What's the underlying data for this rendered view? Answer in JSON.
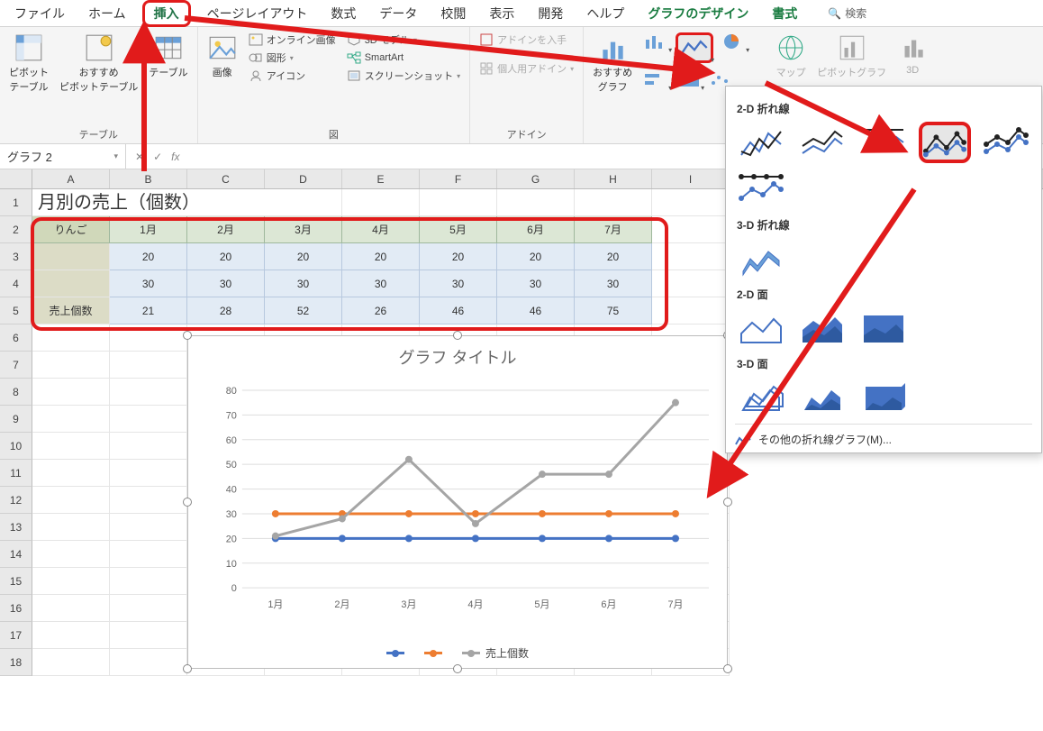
{
  "tabs": {
    "file": "ファイル",
    "home": "ホーム",
    "insert": "挿入",
    "layout": "ページレイアウト",
    "formula": "数式",
    "data": "データ",
    "review": "校閲",
    "view": "表示",
    "dev": "開発",
    "help": "ヘルプ",
    "chartdesign": "グラフのデザイン",
    "format": "書式",
    "search": "検索"
  },
  "ribbon": {
    "group_table": "テーブル",
    "pivot": "ピボット\nテーブル",
    "recpivot": "おすすめ\nピボットテーブル",
    "table": "テーブル",
    "group_illust": "図",
    "picture": "画像",
    "online_image": "オンライン画像",
    "shapes": "図形",
    "icons": "アイコン",
    "model3d": "3D モデル",
    "smartart": "SmartArt",
    "screenshot": "スクリーンショット",
    "group_addin": "アドイン",
    "get_addin": "アドインを入手",
    "my_addin": "個人用アドイン",
    "rec_chart": "おすすめ\nグラフ",
    "map": "マップ",
    "pivotchart": "ピボットグラフ",
    "threeD": "3D"
  },
  "namebox": "グラフ 2",
  "sheet": {
    "cols": [
      "A",
      "B",
      "C",
      "D",
      "E",
      "F",
      "G",
      "H",
      "I"
    ],
    "title": "月別の売上（個数）",
    "header_first": "りんご",
    "months": [
      "1月",
      "2月",
      "3月",
      "4月",
      "5月",
      "6月",
      "7月"
    ],
    "row3": [
      "",
      "20",
      "20",
      "20",
      "20",
      "20",
      "20",
      "20"
    ],
    "row4": [
      "",
      "30",
      "30",
      "30",
      "30",
      "30",
      "30",
      "30"
    ],
    "row5": [
      "売上個数",
      "21",
      "28",
      "52",
      "26",
      "46",
      "46",
      "75"
    ]
  },
  "chart": {
    "title": "グラフ タイトル",
    "legend": [
      "",
      "",
      "売上個数"
    ],
    "colors": {
      "s1": "#4472C4",
      "s2": "#ED7D31",
      "s3": "#A5A5A5"
    }
  },
  "chart_data": {
    "type": "line",
    "categories": [
      "1月",
      "2月",
      "3月",
      "4月",
      "5月",
      "6月",
      "7月"
    ],
    "series": [
      {
        "name": "",
        "values": [
          20,
          20,
          20,
          20,
          20,
          20,
          20
        ],
        "color": "#4472C4"
      },
      {
        "name": "",
        "values": [
          30,
          30,
          30,
          30,
          30,
          30,
          30
        ],
        "color": "#ED7D31"
      },
      {
        "name": "売上個数",
        "values": [
          21,
          28,
          52,
          26,
          46,
          46,
          75
        ],
        "color": "#A5A5A5"
      }
    ],
    "title": "グラフ タイトル",
    "xlabel": "",
    "ylabel": "",
    "ylim": [
      0,
      80
    ],
    "yticks": [
      0,
      10,
      20,
      30,
      40,
      50,
      60,
      70,
      80
    ]
  },
  "dropdown": {
    "sec_2d_line": "2-D 折れ線",
    "sec_3d_line": "3-D 折れ線",
    "sec_2d_area": "2-D 面",
    "sec_3d_area": "3-D 面",
    "more": "その他の折れ線グラフ(M)..."
  }
}
